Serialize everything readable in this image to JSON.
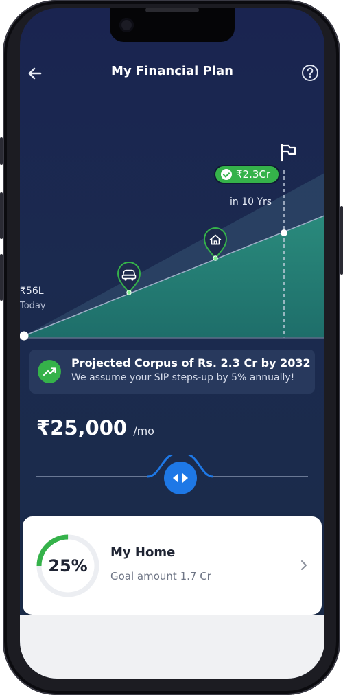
{
  "header": {
    "title": "My Financial Plan",
    "back_icon": "arrow-left-icon",
    "help_icon": "question-circle-icon"
  },
  "chart_data": {
    "type": "area",
    "x_labels": [
      "Today",
      "in 10 Yrs"
    ],
    "start_value_label": "₹56L",
    "start_caption": "Today",
    "end_value_label": "₹2.3Cr",
    "end_caption": "in 10 Yrs",
    "milestones": [
      {
        "name": "car",
        "icon": "car-icon"
      },
      {
        "name": "home",
        "icon": "home-icon"
      }
    ],
    "end_icon": "flag-icon"
  },
  "info": {
    "icon": "trending-up-icon",
    "title": "Projected Corpus of Rs. 2.3 Cr by 2032",
    "subtitle": "We assume your SIP steps-up by 5% annually!"
  },
  "sip": {
    "amount": "₹25,000",
    "unit": "/mo",
    "slider_icon": "left-right-arrows-icon"
  },
  "goal": {
    "percent_text": "25%",
    "progress": 0.25,
    "name": "My Home",
    "detail": "Goal amount 1.7 Cr",
    "chevron_icon": "chevron-right-icon"
  },
  "colors": {
    "accent_green": "#35b24a",
    "slider_blue": "#1e78e6",
    "background_navy": "#1b2a4f"
  }
}
